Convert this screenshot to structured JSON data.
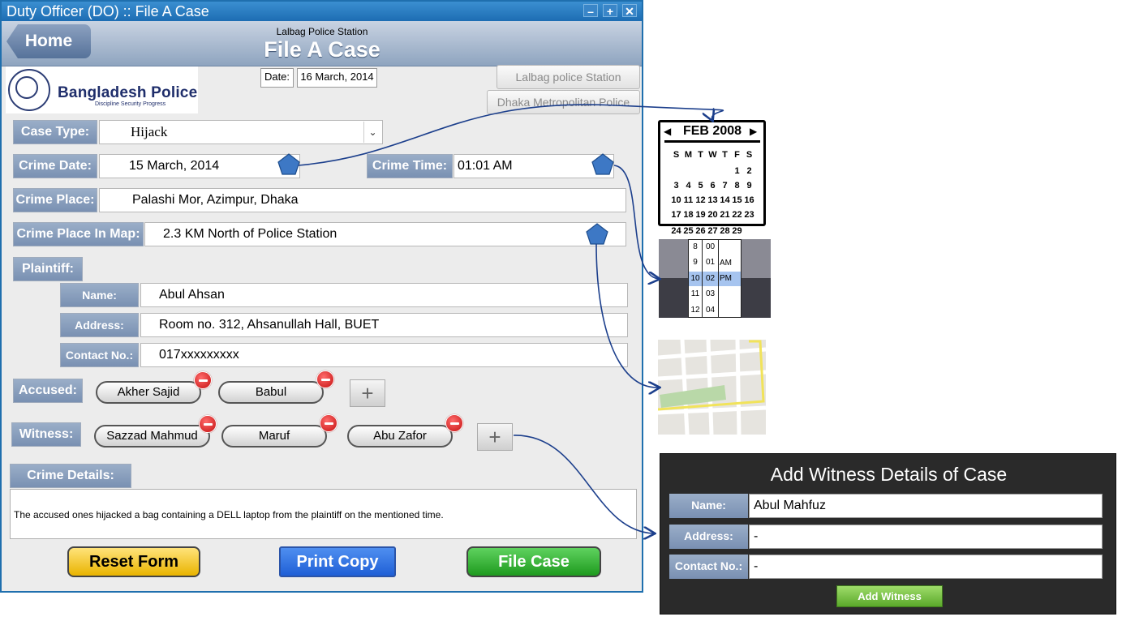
{
  "window": {
    "title": "Duty Officer (DO) :: File A Case",
    "controls": {
      "minimize": "–",
      "maximize": "+",
      "close": "✕"
    }
  },
  "header": {
    "home_label": "Home",
    "station": "Lalbag Police Station",
    "title": "File A Case"
  },
  "logo": {
    "name": "Bangladesh Police",
    "tagline": "Discipline Security Progress"
  },
  "date": {
    "label": "Date:",
    "value": "16 March, 2014"
  },
  "station_buttons": [
    "Lalbag police Station",
    "Dhaka Metropolitan Police"
  ],
  "form": {
    "case_type": {
      "label": "Case Type:",
      "value": "Hijack"
    },
    "crime_date": {
      "label": "Crime Date:",
      "value": "15 March, 2014"
    },
    "crime_time": {
      "label": "Crime Time:",
      "value": "01:01 AM"
    },
    "crime_place": {
      "label": "Crime Place:",
      "value": "Palashi Mor, Azimpur, Dhaka"
    },
    "crime_place_map": {
      "label": "Crime Place In Map:",
      "value": "2.3 KM North of Police Station"
    },
    "plaintiff": {
      "label": "Plaintiff:",
      "name_label": "Name:",
      "name": "Abul Ahsan",
      "address_label": "Address:",
      "address": "Room no. 312, Ahsanullah Hall, BUET",
      "contact_label": "Contact No.:",
      "contact": "017xxxxxxxxx"
    },
    "accused": {
      "label": "Accused:",
      "items": [
        "Akher Sajid",
        "Babul"
      ]
    },
    "witness": {
      "label": "Witness:",
      "items": [
        "Sazzad Mahmud",
        "Maruf",
        "Abu Zafor"
      ]
    },
    "crime_details": {
      "label": "Crime Details:",
      "value": "The accused ones hijacked a bag containing a DELL laptop from the plaintiff on the mentioned time."
    }
  },
  "buttons": {
    "reset": "Reset Form",
    "print": "Print Copy",
    "file": "File Case"
  },
  "calendar": {
    "month": "FEB 2008",
    "weekdays": [
      "S",
      "M",
      "T",
      "W",
      "T",
      "F",
      "S"
    ],
    "rows": [
      [
        "",
        "",
        "",
        "",
        "",
        "1",
        "2"
      ],
      [
        "3",
        "4",
        "5",
        "6",
        "7",
        "8",
        "9"
      ],
      [
        "10",
        "11",
        "12",
        "13",
        "14",
        "15",
        "16"
      ],
      [
        "17",
        "18",
        "19",
        "20",
        "21",
        "22",
        "23"
      ],
      [
        "24",
        "25",
        "26",
        "27",
        "28",
        "29",
        ""
      ]
    ]
  },
  "time_picker": {
    "hours": [
      "8",
      "9",
      "10",
      "11",
      "12"
    ],
    "minutes": [
      "00",
      "01",
      "02",
      "03",
      "04"
    ],
    "ampm": [
      "AM",
      "PM"
    ]
  },
  "witness_panel": {
    "title": "Add Witness Details of Case",
    "name_label": "Name:",
    "name": "Abul Mahfuz",
    "address_label": "Address:",
    "address": "-",
    "contact_label": "Contact No.:",
    "contact": "-",
    "button": "Add Witness"
  },
  "colors": {
    "accent": "#7990b2",
    "title_bar": "#1d6db3",
    "minus": "#c41010"
  }
}
